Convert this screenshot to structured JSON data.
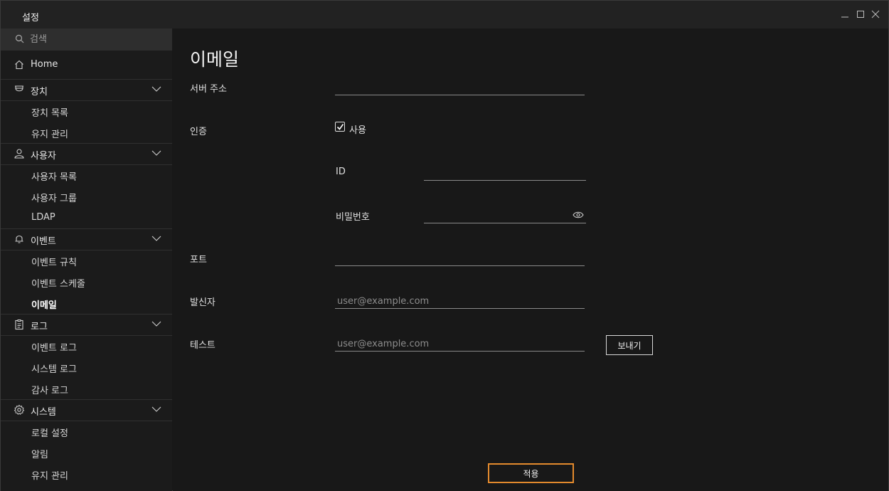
{
  "window": {
    "title": "설정"
  },
  "search": {
    "placeholder": "검색"
  },
  "sidebar": {
    "home": "Home",
    "groups": [
      {
        "label": "장치",
        "icon": "device-icon",
        "items": [
          "장치 목록",
          "유지 관리"
        ]
      },
      {
        "label": "사용자",
        "icon": "user-icon",
        "items": [
          "사용자 목록",
          "사용자 그룹",
          "LDAP"
        ]
      },
      {
        "label": "이벤트",
        "icon": "bell-icon",
        "items": [
          "이벤트 규칙",
          "이벤트 스케줄",
          "이메일"
        ]
      },
      {
        "label": "로그",
        "icon": "clipboard-icon",
        "items": [
          "이벤트 로그",
          "시스템 로그",
          "감사 로그"
        ]
      },
      {
        "label": "시스템",
        "icon": "gear-icon",
        "items": [
          "로컬 설정",
          "알림",
          "유지 관리"
        ]
      }
    ],
    "active_item": "이메일"
  },
  "main": {
    "title": "이메일",
    "server_label": "서버 주소",
    "server_value": "",
    "auth_label": "인증",
    "auth_checkbox_label": "사용",
    "auth_enabled": true,
    "id_label": "ID",
    "id_value": "",
    "password_label": "비밀번호",
    "password_value": "",
    "port_label": "포트",
    "port_value": "",
    "sender_label": "발신자",
    "sender_placeholder": "user@example.com",
    "test_label": "테스트",
    "test_placeholder": "user@example.com",
    "send_button": "보내기",
    "apply_button": "적용"
  },
  "colors": {
    "accent": "#e38a2d",
    "background": "#181818",
    "sidebar": "#1b1b1b",
    "titlebar": "#222222"
  }
}
